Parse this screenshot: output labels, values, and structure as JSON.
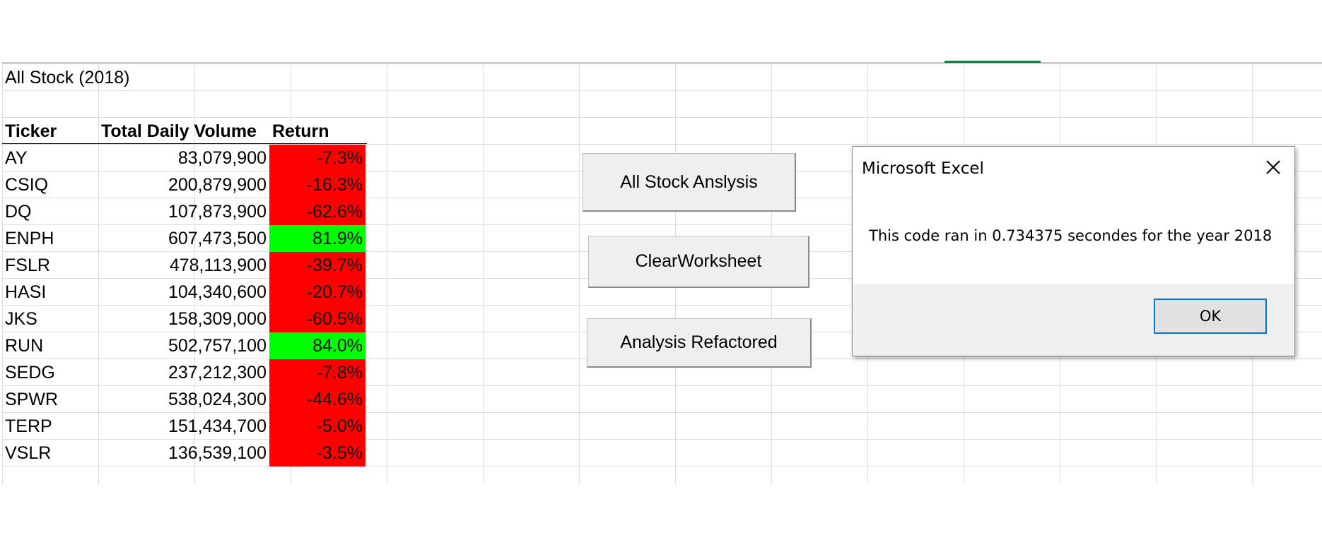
{
  "sheet": {
    "title": "All Stock (2018)",
    "headers": {
      "ticker": "Ticker",
      "volume": "Total Daily Volume",
      "return": "Return"
    },
    "rows": [
      {
        "ticker": "AY",
        "volume": "83,079,900",
        "return": "-7.3%",
        "status": "negative"
      },
      {
        "ticker": "CSIQ",
        "volume": "200,879,900",
        "return": "-16.3%",
        "status": "negative"
      },
      {
        "ticker": "DQ",
        "volume": "107,873,900",
        "return": "-62.6%",
        "status": "negative"
      },
      {
        "ticker": "ENPH",
        "volume": "607,473,500",
        "return": "81.9%",
        "status": "positive"
      },
      {
        "ticker": "FSLR",
        "volume": "478,113,900",
        "return": "-39.7%",
        "status": "negative"
      },
      {
        "ticker": "HASI",
        "volume": "104,340,600",
        "return": "-20.7%",
        "status": "negative"
      },
      {
        "ticker": "JKS",
        "volume": "158,309,000",
        "return": "-60.5%",
        "status": "negative"
      },
      {
        "ticker": "RUN",
        "volume": "502,757,100",
        "return": "84.0%",
        "status": "positive"
      },
      {
        "ticker": "SEDG",
        "volume": "237,212,300",
        "return": "-7.8%",
        "status": "negative"
      },
      {
        "ticker": "SPWR",
        "volume": "538,024,300",
        "return": "-44.6%",
        "status": "negative"
      },
      {
        "ticker": "TERP",
        "volume": "151,434,700",
        "return": "-5.0%",
        "status": "negative"
      },
      {
        "ticker": "VSLR",
        "volume": "136,539,100",
        "return": "-3.5%",
        "status": "negative"
      }
    ],
    "colors": {
      "negative": "#ff0000",
      "positive": "#00ff00"
    }
  },
  "buttons": {
    "all_stock": "All Stock Anslysis",
    "clear": "ClearWorksheet",
    "refactored": "Analysis Refactored"
  },
  "dialog": {
    "title": "Microsoft Excel",
    "message": "This code ran in 0.734375 secondes for the year 2018",
    "ok": "OK",
    "close_icon": "close-icon"
  }
}
